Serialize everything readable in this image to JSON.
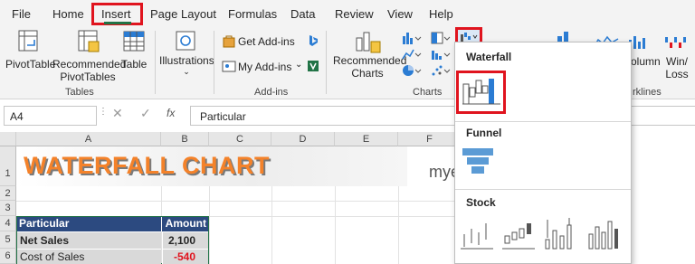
{
  "menu": {
    "tabs": [
      "File",
      "Home",
      "Insert",
      "Page Layout",
      "Formulas",
      "Data",
      "Review",
      "View",
      "Help"
    ],
    "active": "Insert"
  },
  "ribbon": {
    "tables": {
      "pivottable": "PivotTable",
      "recommended_l1": "Recommended",
      "recommended_l2": "PivotTables",
      "table": "Table",
      "group": "Tables"
    },
    "illustrations": {
      "label": "Illustrations"
    },
    "addins": {
      "get": "Get Add-ins",
      "my": "My Add-ins",
      "group": "Add-ins"
    },
    "charts": {
      "rec_l1": "Recommended",
      "rec_l2": "Charts",
      "group": "Charts"
    },
    "right": {
      "column_partial": "olumn",
      "winloss_l1": "Win/",
      "winloss_l2": "Loss",
      "sparklines_partial": "rklines"
    }
  },
  "formula_bar": {
    "name_box": "A4",
    "fx": "fx",
    "content": "Particular"
  },
  "grid": {
    "columns": [
      "A",
      "B",
      "C",
      "D",
      "E",
      "F"
    ],
    "rows": [
      "1",
      "2",
      "3",
      "4",
      "5",
      "6"
    ],
    "title": "WATERFALL CHART",
    "watermark": "mye",
    "table": {
      "headers": [
        "Particular",
        "Amount"
      ],
      "rows": [
        {
          "particular": "Net Sales",
          "amount": "2,100"
        },
        {
          "particular": "Cost of Sales",
          "amount": "-540"
        }
      ]
    }
  },
  "dropdown": {
    "waterfall": "Waterfall",
    "funnel": "Funnel",
    "stock": "Stock"
  },
  "colors": {
    "highlight": "#e0141e",
    "excel_green": "#217346",
    "table_header": "#2c4a80",
    "title_orange": "#f4822a",
    "negative": "#e0141e",
    "chart_blue": "#5b9bd5"
  }
}
